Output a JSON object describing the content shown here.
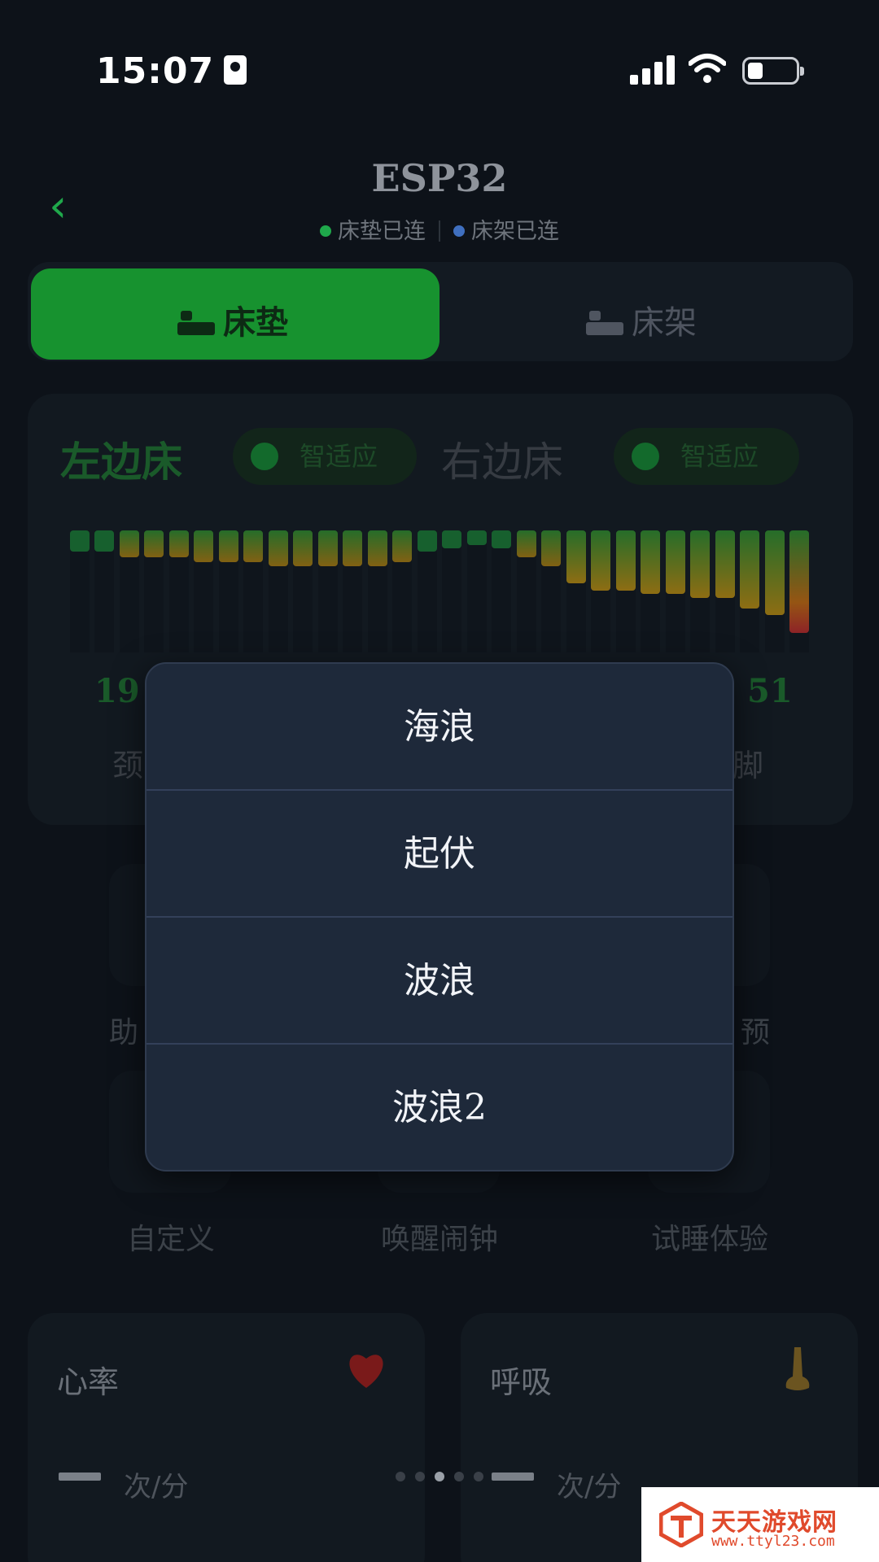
{
  "status_bar": {
    "time": "15:07"
  },
  "header": {
    "title": "ESP32",
    "mattress_status": "床垫已连",
    "frame_status": "床架已连",
    "colors": {
      "accent": "#17922f",
      "mattress_dot": "#1fa84b",
      "frame_dot": "#3f6fbf"
    }
  },
  "tabs": {
    "mattress": "床垫",
    "frame": "床架",
    "active": "床垫"
  },
  "bed_card": {
    "left_label": "左边床",
    "right_label": "右边床",
    "left_mode": "智适应",
    "right_mode": "智适应",
    "left_value": "19",
    "right_value": "51",
    "left_zone_partial": "颈",
    "right_zone_partial": "脚",
    "pressure_levels": [
      0.12,
      0.12,
      0.15,
      0.15,
      0.15,
      0.18,
      0.18,
      0.18,
      0.2,
      0.2,
      0.2,
      0.2,
      0.2,
      0.18,
      0.12,
      0.1,
      0.08,
      0.1,
      0.15,
      0.2,
      0.3,
      0.34,
      0.34,
      0.36,
      0.36,
      0.38,
      0.38,
      0.44,
      0.48,
      0.58
    ]
  },
  "functions": {
    "row1_left_partial": "助",
    "row1_right_partial": "预",
    "custom": "自定义",
    "alarm": "唤醒闹钟",
    "trial": "试睡体验"
  },
  "vitals": {
    "heart": {
      "title": "心率",
      "value": "--",
      "unit": "次/分"
    },
    "breath": {
      "title": "呼吸",
      "value": "--",
      "unit": "次/分"
    }
  },
  "modal": {
    "options": [
      "海浪",
      "起伏",
      "波浪",
      "波浪2"
    ]
  },
  "watermark": {
    "title": "天天游戏网",
    "url": "www.ttyl23.com"
  }
}
